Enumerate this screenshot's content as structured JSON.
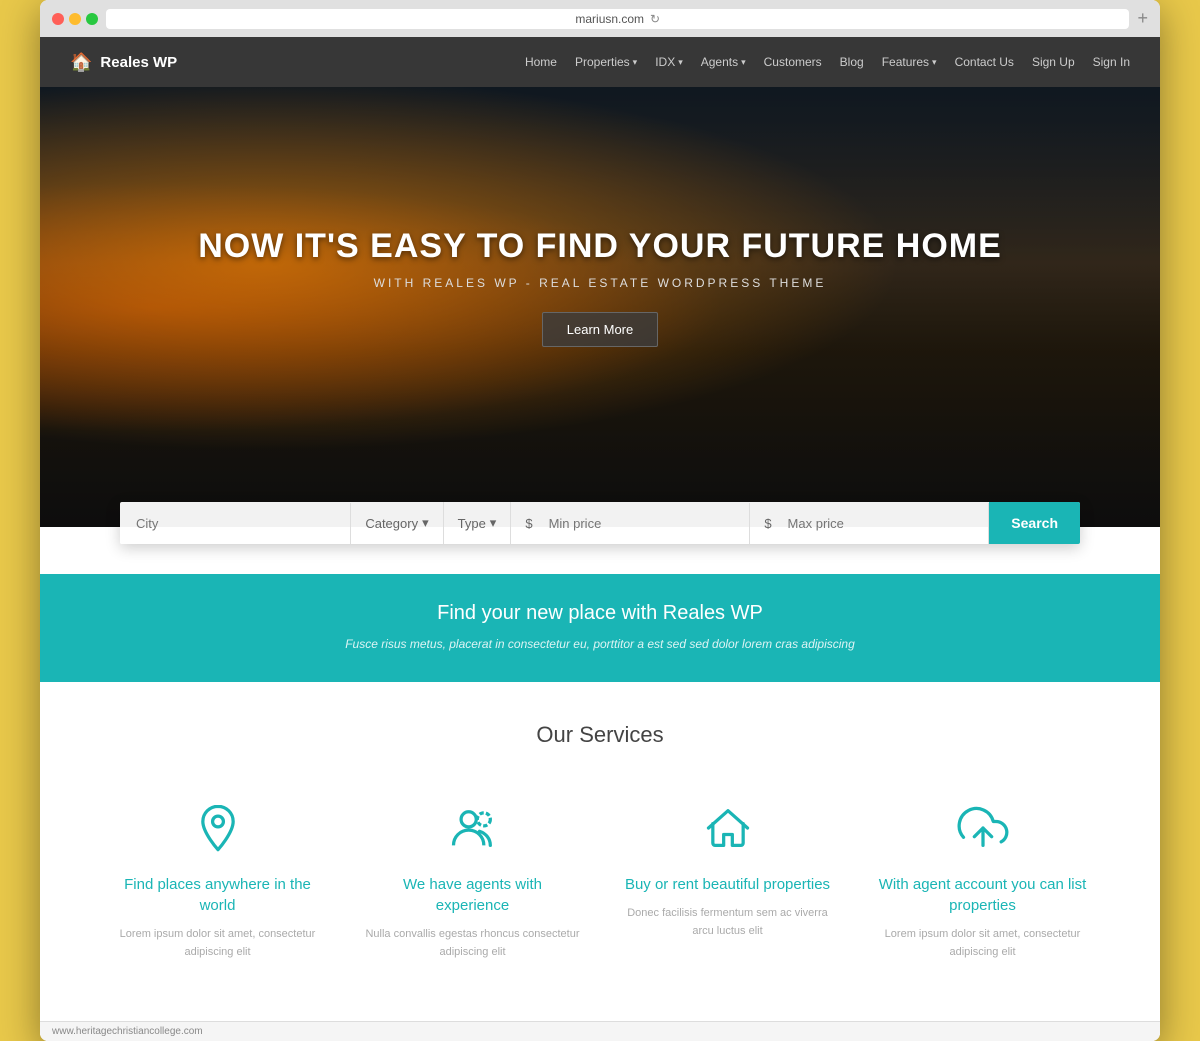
{
  "browser": {
    "url": "mariusn.com",
    "add_tab": "+"
  },
  "navbar": {
    "logo": "Reales WP",
    "logo_icon": "🏠",
    "links": [
      {
        "label": "Home",
        "dropdown": false
      },
      {
        "label": "Properties",
        "dropdown": true
      },
      {
        "label": "IDX",
        "dropdown": true
      },
      {
        "label": "Agents",
        "dropdown": true
      },
      {
        "label": "Customers",
        "dropdown": false
      },
      {
        "label": "Blog",
        "dropdown": false
      },
      {
        "label": "Features",
        "dropdown": true
      },
      {
        "label": "Contact Us",
        "dropdown": false
      },
      {
        "label": "Sign Up",
        "dropdown": false
      },
      {
        "label": "Sign In",
        "dropdown": false
      }
    ]
  },
  "hero": {
    "title": "NOW IT'S EASY TO FIND YOUR FUTURE HOME",
    "subtitle": "WITH REALES WP - REAL ESTATE WORDPRESS THEME",
    "cta_button": "Learn More"
  },
  "search": {
    "city_placeholder": "City",
    "category_label": "Category",
    "type_label": "Type",
    "min_price_placeholder": "Min price",
    "max_price_placeholder": "Max price",
    "search_button": "Search",
    "currency_symbol": "$"
  },
  "banner": {
    "title": "Find your new place with Reales WP",
    "subtitle": "Fusce risus metus, placerat in consectetur eu, porttitor a est sed sed dolor lorem cras adipiscing"
  },
  "services": {
    "section_title": "Our Services",
    "items": [
      {
        "id": "find-places",
        "icon": "location-pin",
        "name": "Find places anywhere in the world",
        "description": "Lorem ipsum dolor sit amet, consectetur adipiscing elit"
      },
      {
        "id": "agents",
        "icon": "person",
        "name": "We have agents with experience",
        "description": "Nulla convallis egestas rhoncus consectetur adipiscing elit"
      },
      {
        "id": "buy-rent",
        "icon": "house",
        "name": "Buy or rent beautiful properties",
        "description": "Donec facilisis fermentum sem ac viverra arcu luctus elit"
      },
      {
        "id": "agent-account",
        "icon": "cloud-upload",
        "name": "With agent account you can list properties",
        "description": "Lorem ipsum dolor sit amet, consectetur adipiscing elit"
      }
    ]
  },
  "status_bar": {
    "url": "www.heritagechristiancollege.com"
  }
}
